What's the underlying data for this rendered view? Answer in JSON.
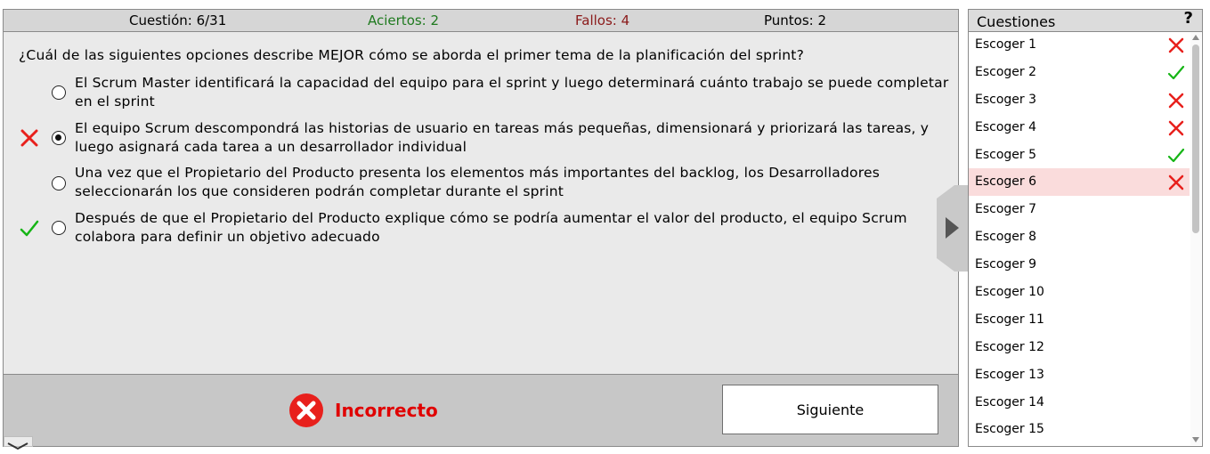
{
  "status": {
    "question": "Cuestión: 6/31",
    "hits": "Aciertos: 2",
    "misses": "Fallos: 4",
    "points": "Puntos: 2"
  },
  "question_text": "¿Cuál de las siguientes opciones describe MEJOR cómo se aborda el primer tema de la planificación del sprint?",
  "options": [
    {
      "text": "El Scrum Master identificará la capacidad del equipo para el sprint y luego determinará cuánto trabajo se puede completar en el sprint",
      "selected": false,
      "mark": ""
    },
    {
      "text": "El equipo Scrum descompondrá las historias de usuario en tareas más pequeñas, dimensionará y priorizará las tareas, y luego asignará cada tarea a un desarrollador individual",
      "selected": true,
      "mark": "cross-icon"
    },
    {
      "text": "Una vez que el Propietario del Producto presenta los elementos más importantes del backlog, los Desarrolladores seleccionarán los que consideren podrán completar durante el sprint",
      "selected": false,
      "mark": ""
    },
    {
      "text": "Después de que el Propietario del Producto explique cómo se podría aumentar el valor del producto, el equipo Scrum colabora para definir un objetivo adecuado",
      "selected": false,
      "mark": "check-icon"
    }
  ],
  "result": "Incorrecto",
  "next_button": "Siguiente",
  "side": {
    "title": "Cuestiones",
    "help": "?",
    "items": [
      {
        "label": "Escoger 1",
        "status": "wrong"
      },
      {
        "label": "Escoger 2",
        "status": "right"
      },
      {
        "label": "Escoger 3",
        "status": "wrong"
      },
      {
        "label": "Escoger 4",
        "status": "wrong"
      },
      {
        "label": "Escoger 5",
        "status": "right"
      },
      {
        "label": "Escoger 6",
        "status": "wrong",
        "active": true
      },
      {
        "label": "Escoger 7",
        "status": ""
      },
      {
        "label": "Escoger 8",
        "status": ""
      },
      {
        "label": "Escoger 9",
        "status": ""
      },
      {
        "label": "Escoger 10",
        "status": ""
      },
      {
        "label": "Escoger 11",
        "status": ""
      },
      {
        "label": "Escoger 12",
        "status": ""
      },
      {
        "label": "Escoger 13",
        "status": ""
      },
      {
        "label": "Escoger 14",
        "status": ""
      },
      {
        "label": "Escoger 15",
        "status": ""
      }
    ]
  },
  "colors": {
    "hits": "#1f7a1f",
    "misses": "#8b1a1a",
    "cross": "#e8201c",
    "check": "#16b516",
    "result": "#e00000",
    "active_row": "#fadcdc"
  }
}
